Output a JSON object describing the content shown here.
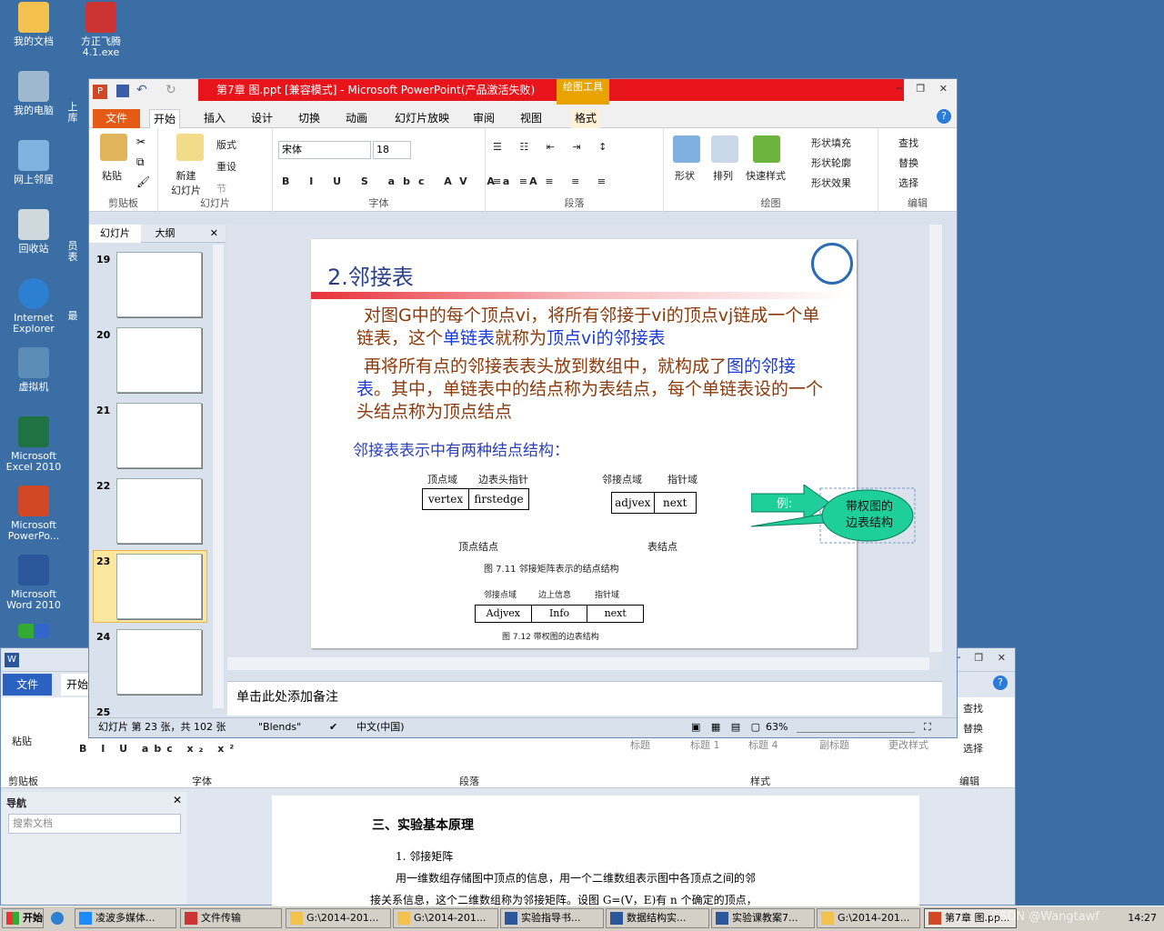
{
  "desktop": {
    "icons": [
      "我的文档",
      "方正飞腾\n4.1.exe",
      "我的电脑",
      "网上邻居",
      "回收站",
      "Internet\nExplorer",
      "虚拟机",
      "Microsoft\nExcel 2010",
      "Microsoft\nPowerPo...",
      "Microsoft\nWord 2010"
    ],
    "partial_labels": [
      "上",
      "库",
      "员",
      "表",
      "最"
    ]
  },
  "ppt": {
    "title": "第7章 图.ppt [兼容模式] - Microsoft PowerPoint(产品激活失败)",
    "drawing_tools": "绘图工具",
    "tabs": [
      "文件",
      "开始",
      "插入",
      "设计",
      "切换",
      "动画",
      "幻灯片放映",
      "审阅",
      "视图",
      "格式"
    ],
    "ribbon": {
      "clipboard": {
        "paste": "粘贴",
        "label": "剪贴板"
      },
      "slides": {
        "new_slide": "新建\n幻灯片",
        "layout": "版式",
        "reset": "重设",
        "section": "节",
        "label": "幻灯片"
      },
      "font": {
        "name": "宋体",
        "size": "18",
        "label": "字体"
      },
      "paragraph": {
        "label": "段落"
      },
      "drawing": {
        "shape": "形状",
        "arrange": "排列",
        "quick_styles": "快速样式",
        "fill": "形状填充",
        "outline": "形状轮廓",
        "effects": "形状效果",
        "label": "绘图"
      },
      "editing": {
        "find": "查找",
        "replace": "替换",
        "select": "选择",
        "label": "编辑"
      }
    },
    "side_tabs": [
      "幻灯片",
      "大纲"
    ],
    "thumb_numbers": [
      "19",
      "20",
      "21",
      "22",
      "23",
      "24",
      "25"
    ],
    "slide": {
      "title": "2.邻接表",
      "para1_a": "对图G中的每个顶点vi，将所有邻接于vi的顶点vj链成一个单链表，这个",
      "para1_b": "单链表",
      "para1_c": "就称为",
      "para1_d": "顶点vi的邻接表",
      "para2_a": "再将所有点的邻接表表头放到数组中，就构成了",
      "para2_b": "图的邻接表",
      "para2_c": "。其中，单链表中的结点称为表结点，每个单链表设的一个头结点称为顶点结点",
      "heading2": "邻接表表示中有两种结点结构：",
      "top_labels": [
        "顶点域",
        "边表头指针",
        "邻接点域",
        "指针域"
      ],
      "cells_vertex": [
        "vertex",
        "firstedge"
      ],
      "cells_edge": [
        "adjvex",
        "next"
      ],
      "vertex_node": "顶点结点",
      "edge_node": "表结点",
      "fig711": "图 7.11    邻接矩阵表示的结点结构",
      "weighted_labels": [
        "邻接点域",
        "边上信息",
        "指针域"
      ],
      "weighted_cells": [
        "Adjvex",
        "Info",
        "next"
      ],
      "fig712": "图 7.12    带权图的边表结构",
      "arrow_label": "例:",
      "callout": "带权图的\n边表结构"
    },
    "notes_placeholder": "单击此处添加备注",
    "status": {
      "slide_info": "幻灯片 第 23 张，共 102 张",
      "theme": "\"Blends\"",
      "lang": "中文(中国)",
      "zoom": "63%"
    }
  },
  "word": {
    "file_tab": "文件",
    "start_tab": "开始",
    "groups": [
      "剪贴板",
      "字体",
      "段落",
      "样式",
      "编辑"
    ],
    "styles": [
      "标题",
      "标题 1",
      "标题 4",
      "副标题",
      "更改样式"
    ],
    "editing": [
      "查找",
      "替换",
      "选择"
    ],
    "nav_title": "导航",
    "search_placeholder": "搜索文档",
    "doc": {
      "heading": "三、实验基本原理",
      "item": "1.  邻接矩阵",
      "line1": "用一维数组存储图中顶点的信息，用一个二维数组表示图中各顶点之间的邻",
      "line2": "接关系信息，这个二维数组称为邻接矩阵。设图 G=(V，E)有 n 个确定的顶点，"
    }
  },
  "taskbar": {
    "start": "开始",
    "items": [
      "凌波多媒体...",
      "文件传输",
      "G:\\2014-201...",
      "G:\\2014-201...",
      "实验指导书...",
      "数据结构实...",
      "实验课教案7...",
      "G:\\2014-201...",
      "第7章 图.pp..."
    ],
    "clock": "14:27",
    "watermark": "CSDN @Wangtawf"
  }
}
